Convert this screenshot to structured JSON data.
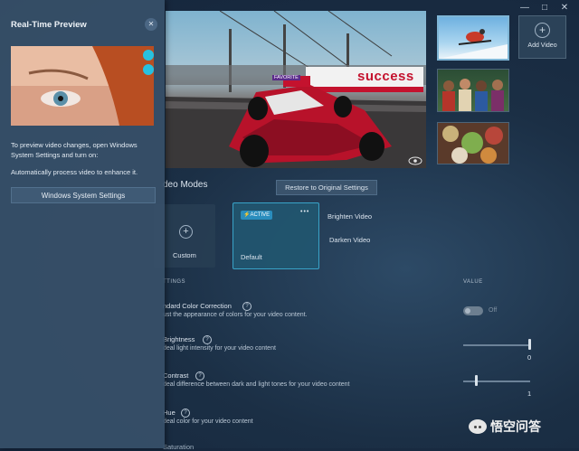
{
  "panel": {
    "title": "Real-Time Preview",
    "instructions": "To preview video changes, open Windows System Settings and turn on:",
    "auto_process": "Automatically process video to enhance it.",
    "settings_button": "Windows System Settings"
  },
  "video": {
    "banner_text": "success",
    "car_tag": "FAVORITE"
  },
  "thumbnails": {
    "add_label": "Add Video"
  },
  "modes": {
    "title": "Video Modes",
    "title_visible": "deo Modes",
    "restore_button": "Restore to Original Settings",
    "custom_label": "Custom",
    "default_label": "Default",
    "active_badge": "ACTIVE",
    "more_glyph": "•••",
    "brighten_label": "Brighten Video",
    "darken_label": "Darken Video"
  },
  "settings": {
    "header": "TTINGS",
    "value_header": "VALUE",
    "color_correction": {
      "label": "ndard Color Correction",
      "desc": "ust the appearance of colors for your video content.",
      "toggle_text": "Off"
    },
    "brightness": {
      "label": "Brightness",
      "desc": "deal light intensity for your video content",
      "value": "0",
      "level": 1.0
    },
    "contrast": {
      "label": "Contrast",
      "desc": "deal difference between dark and light tones for your video content",
      "value": "1",
      "level": 0.2
    },
    "hue": {
      "label": "Hue",
      "desc": "deal color for your video content"
    },
    "next_label": "Saturation"
  },
  "watermark": {
    "text": "悟空问答"
  }
}
